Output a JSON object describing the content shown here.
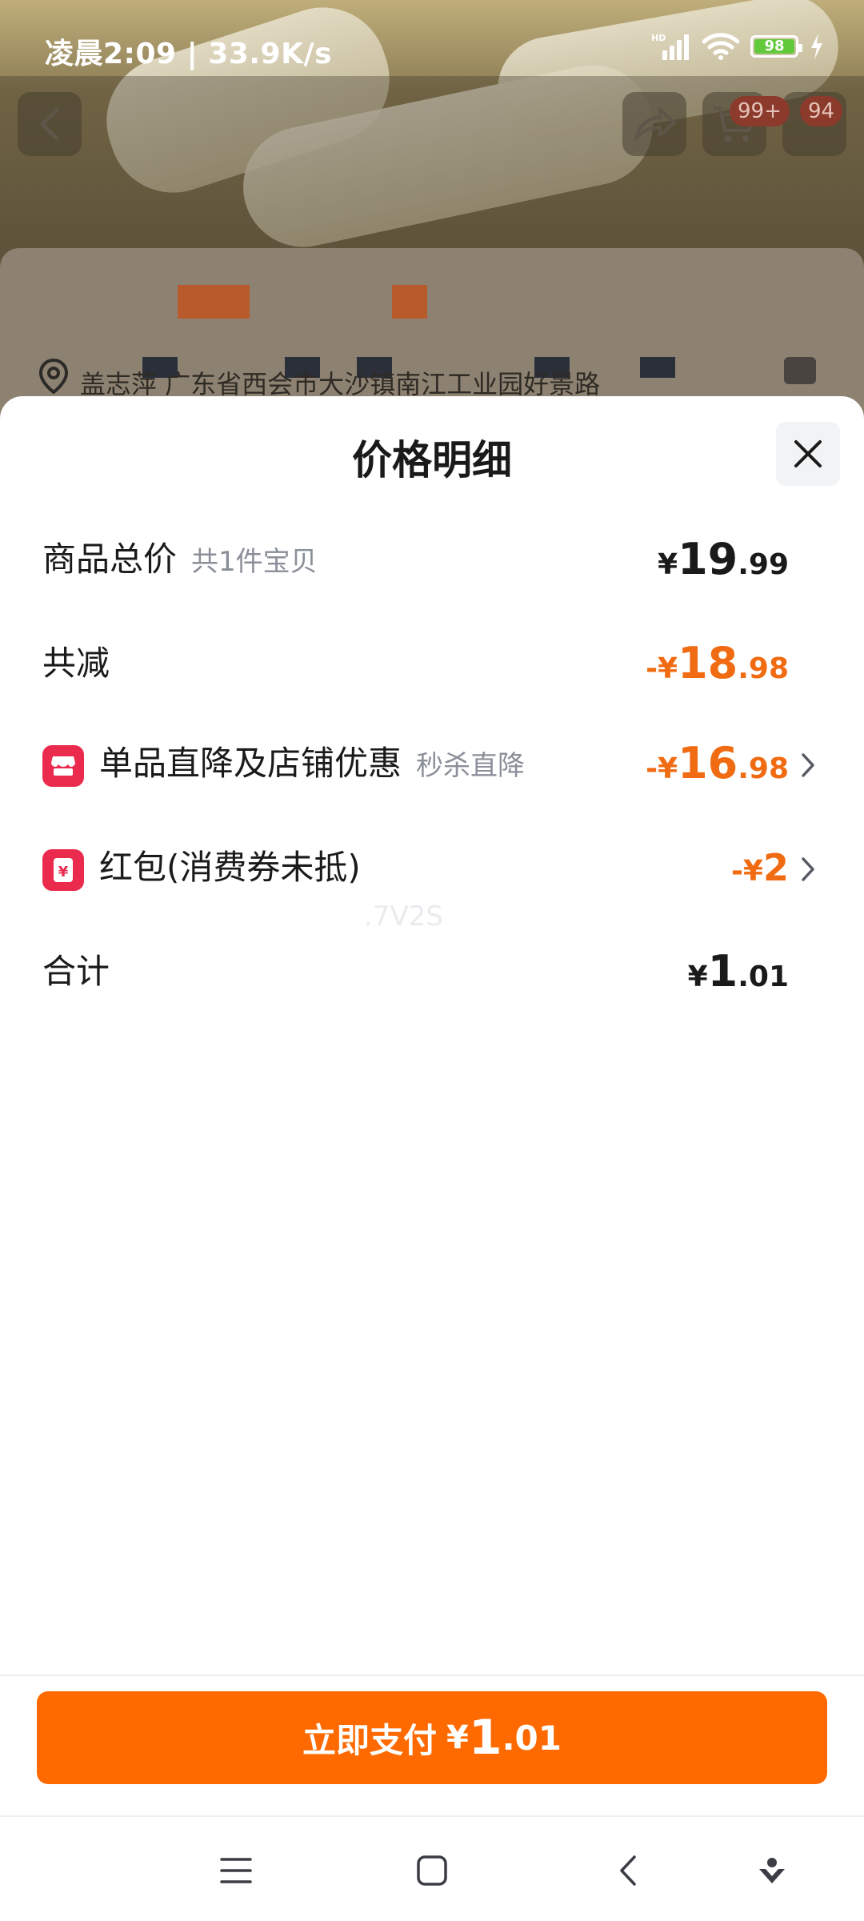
{
  "status_bar": {
    "time": "凌晨2:09 | 33.9K/s",
    "battery": "98"
  },
  "background": {
    "cart_badge": "99+",
    "message_badge": "94",
    "address": "盖志萍 广东省西会市大沙镇南江工业园好景路"
  },
  "sheet": {
    "title": "价格明细",
    "rows": [
      {
        "label": "商品总价",
        "sub": "共1件宝贝",
        "prefix": "¥",
        "int": "19",
        "dec": ".99",
        "color": "#1a1a1a"
      },
      {
        "label": "共减",
        "prefix": "-¥",
        "int": "18",
        "dec": ".98",
        "color": "#f06b12"
      },
      {
        "label": "单品直降及店铺优惠",
        "sub": "秒杀直降",
        "prefix": "-¥",
        "int": "16",
        "dec": ".98",
        "color": "#f06b12",
        "icon": "shop-icon"
      },
      {
        "label": "红包(消费券未抵)",
        "prefix": "-¥",
        "int": "2",
        "dec": "",
        "color": "#f06b12",
        "icon": "red-packet-icon"
      },
      {
        "label": "合计",
        "prefix": "¥",
        "int": "1",
        "dec": ".01",
        "color": "#1a1a1a"
      }
    ],
    "watermark": ".7V2S"
  },
  "pay_button": {
    "label": "立即支付",
    "prefix": "¥",
    "int": "1",
    "dec": ".01",
    "color": "#fe6a00"
  },
  "colors": {
    "accent": "#fe6a00",
    "discount": "#f06b12",
    "icon_red": "#ea2b4e"
  }
}
